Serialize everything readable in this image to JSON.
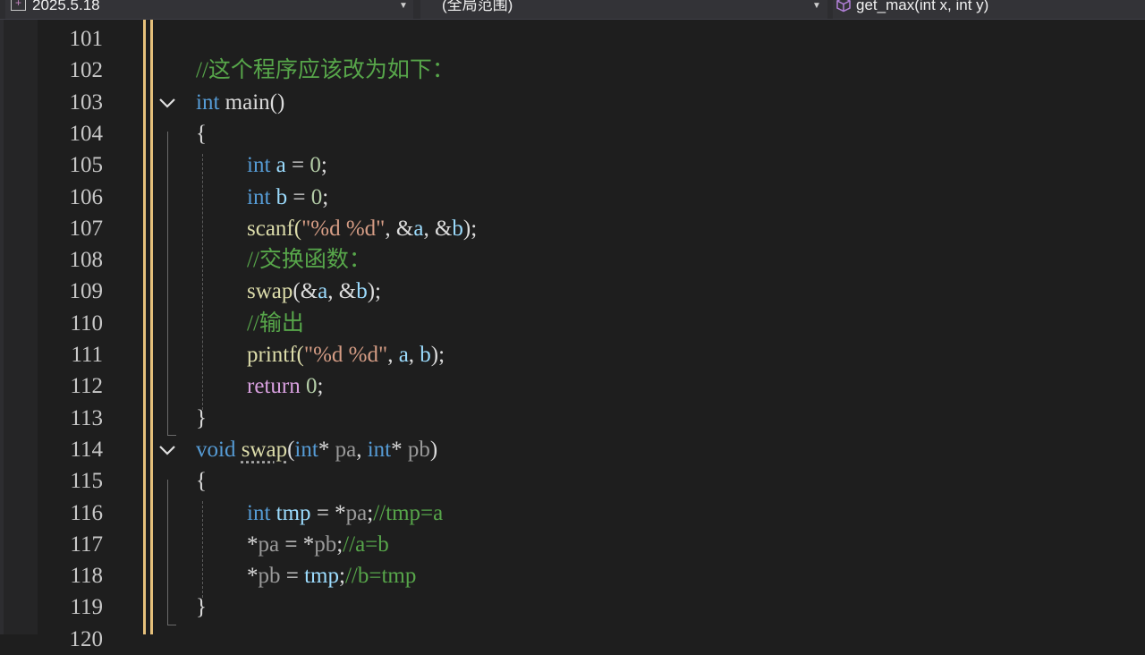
{
  "navbar": {
    "project": "2025.5.18",
    "scope": "(全局范围)",
    "function": "get_max(int x, int y)"
  },
  "icons": {
    "project": "project-icon",
    "function": "cube-icon",
    "dropdown": "chevron-down-icon",
    "fold": "fold-chevron-icon"
  },
  "colors": {
    "keyword": "#569cd6",
    "comment": "#57a64a",
    "string": "#d69d85",
    "number": "#b5cea8",
    "variable": "#9cdcfe",
    "change_bar": "#e5c07b",
    "background": "#1e1e1e"
  },
  "editor": {
    "lines": [
      {
        "n": "101",
        "indent": 0,
        "tokens": []
      },
      {
        "n": "102",
        "indent": 0,
        "tokens": [
          {
            "t": "//这个程序应该改为如下：",
            "c": "cm"
          }
        ]
      },
      {
        "n": "103",
        "indent": 0,
        "fold": true,
        "tokens": [
          {
            "t": "int",
            "c": "kw"
          },
          {
            "t": " main()"
          }
        ]
      },
      {
        "n": "104",
        "indent": 0,
        "tokens": [
          {
            "t": "{"
          }
        ]
      },
      {
        "n": "105",
        "indent": 1,
        "tokens": [
          {
            "t": "int",
            "c": "kw"
          },
          {
            "t": " "
          },
          {
            "t": "a",
            "c": "var"
          },
          {
            "t": " = "
          },
          {
            "t": "0",
            "c": "num"
          },
          {
            "t": ";"
          }
        ]
      },
      {
        "n": "106",
        "indent": 1,
        "tokens": [
          {
            "t": "int",
            "c": "kw"
          },
          {
            "t": " "
          },
          {
            "t": "b",
            "c": "var"
          },
          {
            "t": " = "
          },
          {
            "t": "0",
            "c": "num"
          },
          {
            "t": ";"
          }
        ]
      },
      {
        "n": "107",
        "indent": 1,
        "tokens": [
          {
            "t": "scanf(",
            "c": "fn"
          },
          {
            "t": "\"%d %d\"",
            "c": "str"
          },
          {
            "t": ", &"
          },
          {
            "t": "a",
            "c": "var"
          },
          {
            "t": ", &"
          },
          {
            "t": "b",
            "c": "var"
          },
          {
            "t": ");"
          }
        ]
      },
      {
        "n": "108",
        "indent": 1,
        "tokens": [
          {
            "t": "//交换函数：",
            "c": "cm"
          }
        ]
      },
      {
        "n": "109",
        "indent": 1,
        "tokens": [
          {
            "t": "swap",
            "c": "fn"
          },
          {
            "t": "(&"
          },
          {
            "t": "a",
            "c": "var"
          },
          {
            "t": ", &"
          },
          {
            "t": "b",
            "c": "var"
          },
          {
            "t": ");"
          }
        ]
      },
      {
        "n": "110",
        "indent": 1,
        "tokens": [
          {
            "t": "//输出",
            "c": "cm"
          }
        ]
      },
      {
        "n": "111",
        "indent": 1,
        "tokens": [
          {
            "t": "printf(",
            "c": "fn"
          },
          {
            "t": "\"%d %d\"",
            "c": "str"
          },
          {
            "t": ", "
          },
          {
            "t": "a",
            "c": "var"
          },
          {
            "t": ", "
          },
          {
            "t": "b",
            "c": "var"
          },
          {
            "t": ");"
          }
        ]
      },
      {
        "n": "112",
        "indent": 1,
        "tokens": [
          {
            "t": "return",
            "c": "ctl"
          },
          {
            "t": " "
          },
          {
            "t": "0",
            "c": "num"
          },
          {
            "t": ";"
          }
        ]
      },
      {
        "n": "113",
        "indent": 0,
        "tokens": [
          {
            "t": "}"
          }
        ]
      },
      {
        "n": "114",
        "indent": 0,
        "fold": true,
        "tokens": [
          {
            "t": "void",
            "c": "kw"
          },
          {
            "t": " "
          },
          {
            "t": "swap",
            "c": "fn squig"
          },
          {
            "t": "("
          },
          {
            "t": "int",
            "c": "kw"
          },
          {
            "t": "* "
          },
          {
            "t": "pa",
            "c": "prm"
          },
          {
            "t": ", "
          },
          {
            "t": "int",
            "c": "kw"
          },
          {
            "t": "* "
          },
          {
            "t": "pb",
            "c": "prm"
          },
          {
            "t": ")"
          }
        ]
      },
      {
        "n": "115",
        "indent": 0,
        "tokens": [
          {
            "t": "{"
          }
        ]
      },
      {
        "n": "116",
        "indent": 1,
        "tokens": [
          {
            "t": "int",
            "c": "kw"
          },
          {
            "t": " "
          },
          {
            "t": "tmp",
            "c": "var"
          },
          {
            "t": " = *"
          },
          {
            "t": "pa",
            "c": "prm"
          },
          {
            "t": ";"
          },
          {
            "t": "//tmp=a",
            "c": "cm"
          }
        ]
      },
      {
        "n": "117",
        "indent": 1,
        "tokens": [
          {
            "t": "*"
          },
          {
            "t": "pa",
            "c": "prm"
          },
          {
            "t": " = *"
          },
          {
            "t": "pb",
            "c": "prm"
          },
          {
            "t": ";"
          },
          {
            "t": "//a=b",
            "c": "cm"
          }
        ]
      },
      {
        "n": "118",
        "indent": 1,
        "tokens": [
          {
            "t": "*"
          },
          {
            "t": "pb",
            "c": "prm"
          },
          {
            "t": " = "
          },
          {
            "t": "tmp",
            "c": "var"
          },
          {
            "t": ";"
          },
          {
            "t": "//b=tmp",
            "c": "cm"
          }
        ]
      },
      {
        "n": "119",
        "indent": 0,
        "tokens": [
          {
            "t": "}"
          }
        ]
      },
      {
        "n": "120",
        "indent": 0,
        "tokens": []
      }
    ]
  }
}
